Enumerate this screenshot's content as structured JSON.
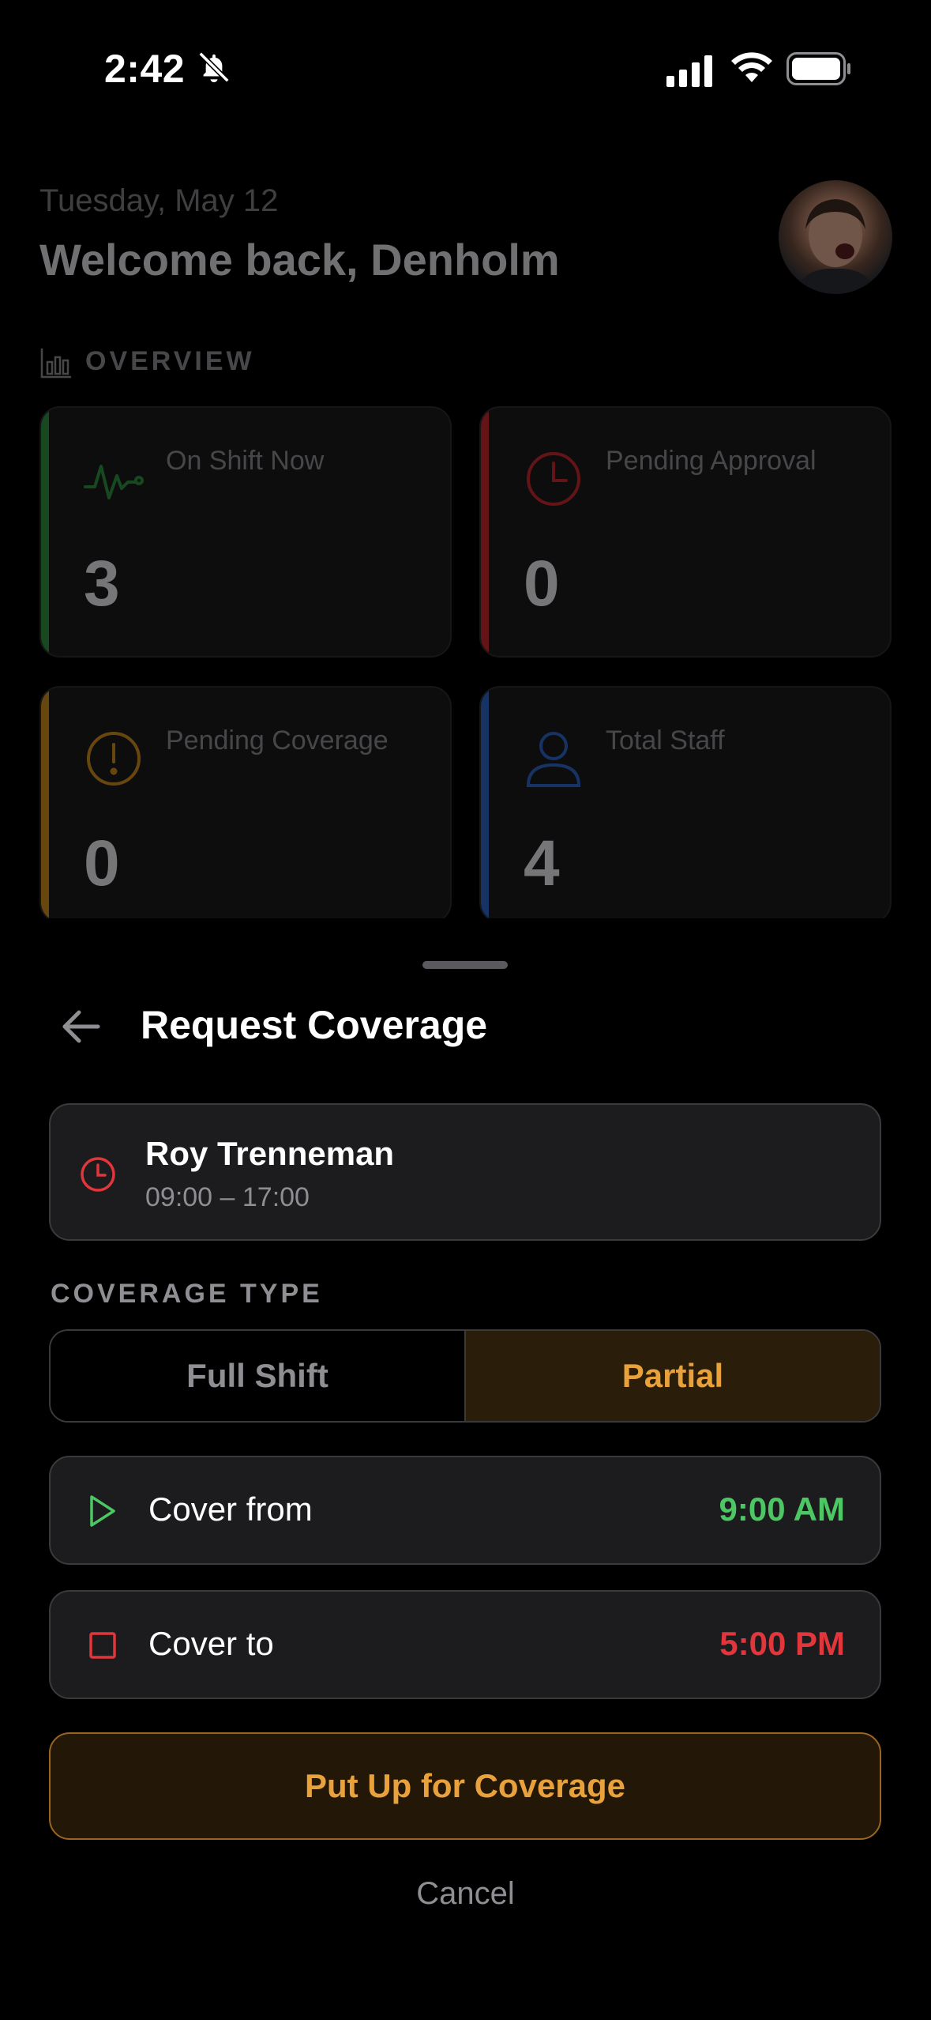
{
  "status_bar": {
    "time": "2:42"
  },
  "dashboard": {
    "date": "Tuesday, May 12",
    "welcome": "Welcome back, Denholm",
    "overview_label": "OVERVIEW",
    "cards": [
      {
        "label": "On Shift Now",
        "value": "3",
        "accent": "#2e8b3e",
        "icon": "activity-icon"
      },
      {
        "label": "Pending Approval",
        "value": "0",
        "accent": "#c1272d",
        "icon": "clock-icon"
      },
      {
        "label": "Pending Coverage",
        "value": "0",
        "accent": "#c98a1e",
        "icon": "alert-circle-icon"
      },
      {
        "label": "Total Staff",
        "value": "4",
        "accent": "#2e62c4",
        "icon": "person-icon"
      }
    ]
  },
  "sheet": {
    "title": "Request Coverage",
    "shift": {
      "name": "Roy Trenneman",
      "time": "09:00 – 17:00"
    },
    "coverage_type_label": "COVERAGE TYPE",
    "segments": {
      "full": "Full Shift",
      "partial": "Partial",
      "selected": "partial"
    },
    "cover_from": {
      "label": "Cover from",
      "value": "9:00 AM",
      "color": "#4cc764"
    },
    "cover_to": {
      "label": "Cover to",
      "value": "5:00 PM",
      "color": "#e0363c"
    },
    "submit_label": "Put Up for Coverage",
    "cancel_label": "Cancel"
  },
  "colors": {
    "accent_orange": "#e9a23b",
    "green": "#4cc764",
    "red": "#e0363c"
  }
}
